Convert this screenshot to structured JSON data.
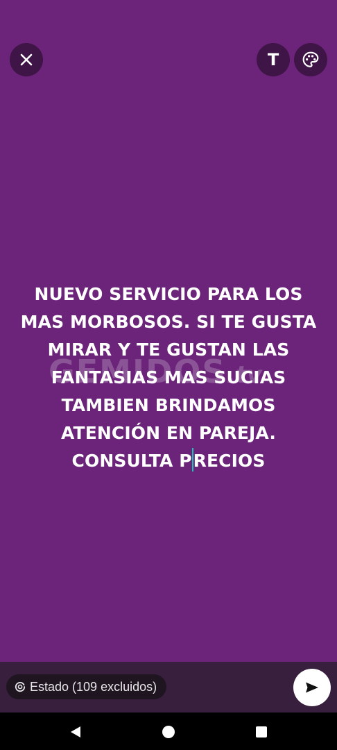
{
  "top_bar": {
    "close_icon": "close-icon",
    "text_button_glyph": "T",
    "palette_icon": "palette-icon"
  },
  "status": {
    "lines": [
      "NUEVO SERVICIO PARA LOS",
      "MAS MORBOSOS. SI TE GUSTA",
      "MIRAR Y TE GUSTAN LAS",
      "FANTASIAS MAS SUCIAS",
      "TAMBIEN BRINDAMOS",
      "ATENCIÓN EN PAREJA."
    ],
    "last_line_before_cursor": "CONSULTA P",
    "last_line_after_cursor": "RECIOS",
    "background_color": "#6B2479",
    "text_color": "#FFFFFF",
    "cursor_color": "#19C2B4"
  },
  "watermark": {
    "main": "GEMIDOS",
    "suffix": ".tv"
  },
  "bottom_bar": {
    "audience_label": "Estado (109 excluidos)",
    "audience_icon": "status-ring-icon",
    "send_icon": "send-icon"
  },
  "nav": {
    "back_icon": "back-triangle-icon",
    "home_icon": "home-circle-icon",
    "recents_icon": "recents-square-icon"
  }
}
